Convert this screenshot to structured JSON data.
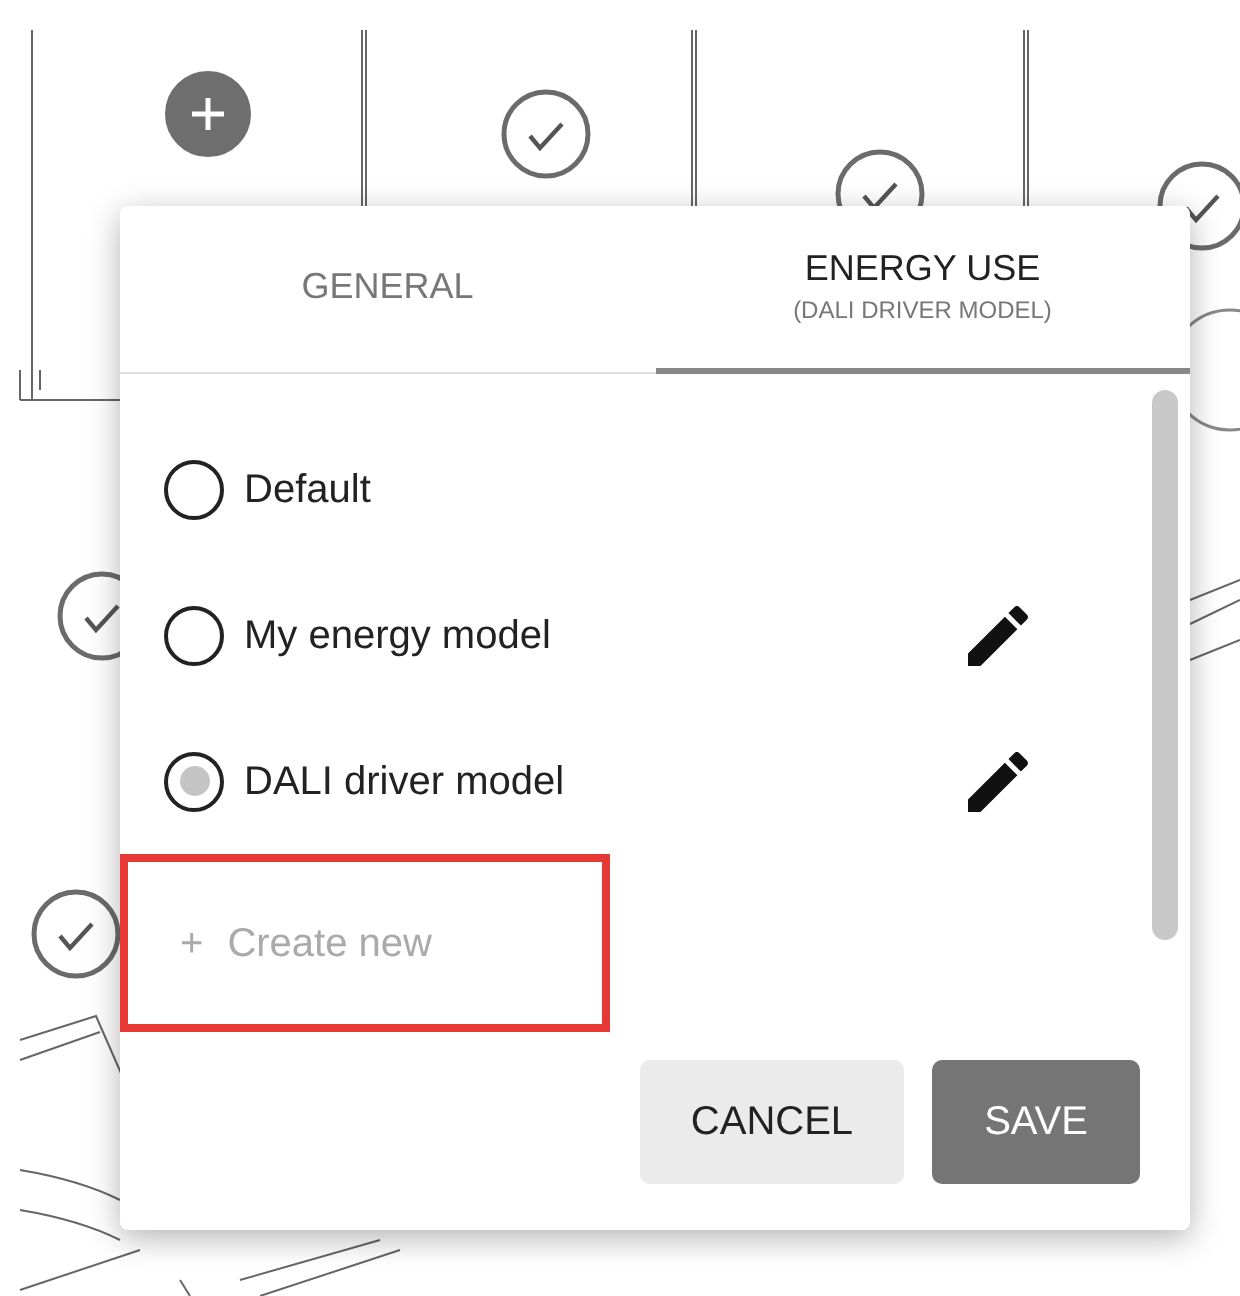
{
  "tabs": [
    {
      "label": "GENERAL",
      "selected": false
    },
    {
      "label": "ENERGY USE",
      "sublabel": "(DALI DRIVER MODEL)",
      "selected": true
    }
  ],
  "options": [
    {
      "label": "Default",
      "selected": false,
      "editable": false
    },
    {
      "label": "My energy model",
      "selected": false,
      "editable": true
    },
    {
      "label": "DALI driver model",
      "selected": true,
      "editable": true
    }
  ],
  "create_new": {
    "icon": "+",
    "label": "Create new",
    "highlighted": true
  },
  "buttons": [
    {
      "label": "CANCEL",
      "kind": "secondary"
    },
    {
      "label": "SAVE",
      "kind": "primary"
    }
  ]
}
